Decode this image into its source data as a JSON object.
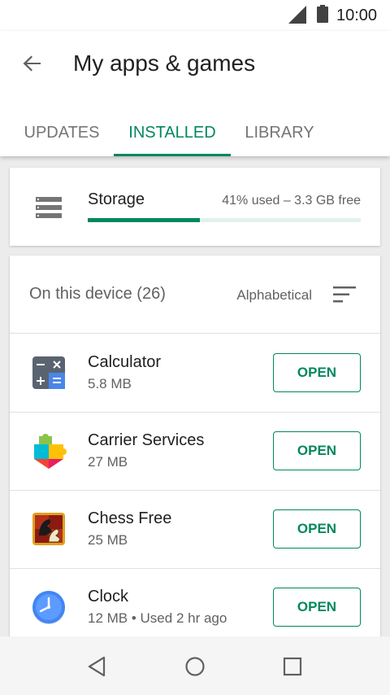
{
  "status_bar": {
    "time": "10:00",
    "icons": [
      "signal-icon",
      "battery-icon"
    ]
  },
  "header": {
    "back_icon": "arrow-back-icon",
    "title": "My apps & games",
    "tabs": [
      {
        "label": "UPDATES",
        "active": false
      },
      {
        "label": "INSTALLED",
        "active": true
      },
      {
        "label": "LIBRARY",
        "active": false
      }
    ]
  },
  "storage": {
    "icon": "storage-icon",
    "label": "Storage",
    "info": "41% used – 3.3 GB free",
    "used_fraction": 0.41
  },
  "apps_section": {
    "title": "On this device (26)",
    "sort_label": "Alphabetical",
    "sort_icon": "sort-icon",
    "apps": [
      {
        "name": "Calculator",
        "meta": "5.8 MB",
        "button": "OPEN",
        "icon": "calculator-app-icon"
      },
      {
        "name": "Carrier Services",
        "meta": "27 MB",
        "button": "OPEN",
        "icon": "carrier-services-app-icon"
      },
      {
        "name": "Chess Free",
        "meta": "25 MB",
        "button": "OPEN",
        "icon": "chess-free-app-icon"
      },
      {
        "name": "Clock",
        "meta": "12 MB • Used 2 hr ago",
        "button": "OPEN",
        "icon": "clock-app-icon"
      }
    ]
  },
  "nav_bar": {
    "buttons": [
      "back-triangle-icon",
      "home-circle-icon",
      "recents-square-icon"
    ]
  },
  "colors": {
    "accent": "#01875f",
    "text_primary": "#212121",
    "text_secondary": "#616161",
    "tab_inactive": "#757575",
    "background": "#ececec",
    "storage_track": "#e3f1ec"
  }
}
